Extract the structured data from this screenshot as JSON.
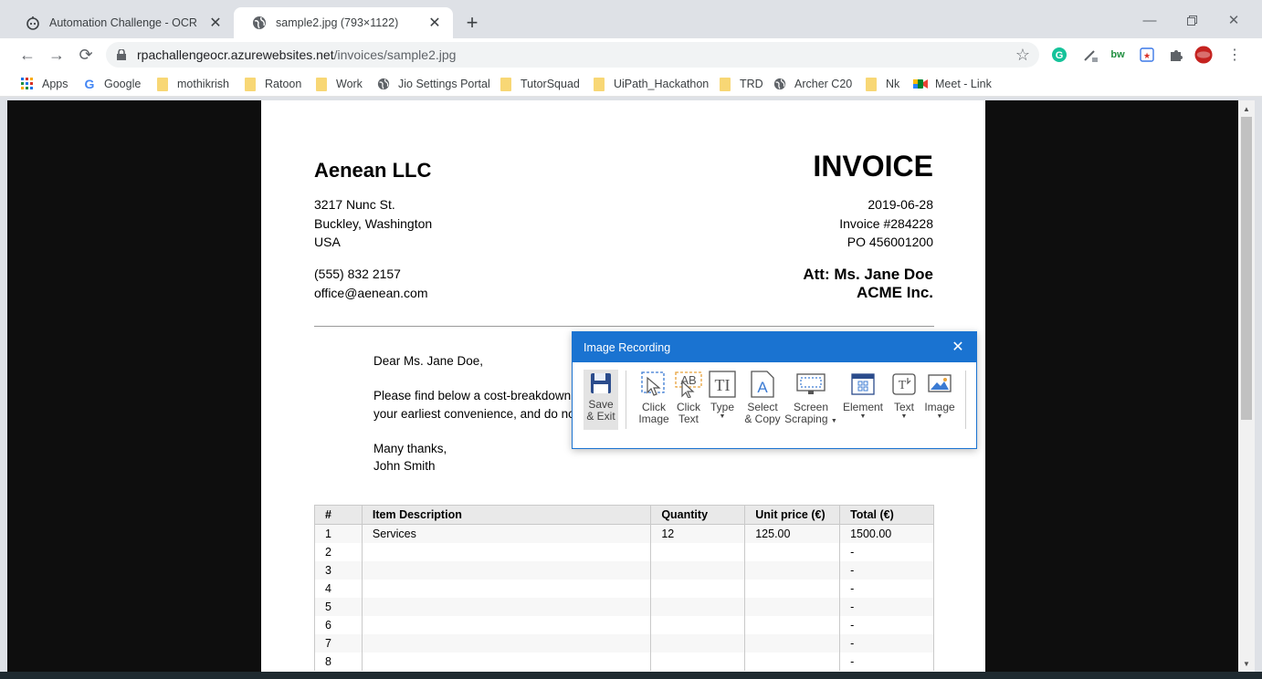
{
  "browser": {
    "tabs": [
      {
        "title": "Automation Challenge - OCR",
        "icon": "robot-icon",
        "active": false
      },
      {
        "title": "sample2.jpg (793×1122)",
        "icon": "globe-icon",
        "active": true
      }
    ],
    "url": {
      "host": "rpachallengeocr.azurewebsites.net",
      "path": "/invoices/sample2.jpg"
    },
    "bookmarks": [
      {
        "label": "Apps",
        "icon": "apps-grid-icon"
      },
      {
        "label": "Google",
        "icon": "google-icon"
      },
      {
        "label": "mothikrish",
        "icon": "folder-icon"
      },
      {
        "label": "Ratoon",
        "icon": "folder-icon"
      },
      {
        "label": "Work",
        "icon": "folder-icon"
      },
      {
        "label": "Jio Settings Portal",
        "icon": "globe-icon"
      },
      {
        "label": "TutorSquad",
        "icon": "folder-icon"
      },
      {
        "label": "UiPath_Hackathon",
        "icon": "folder-icon"
      },
      {
        "label": "TRD",
        "icon": "folder-icon"
      },
      {
        "label": "Archer C20",
        "icon": "globe-icon"
      },
      {
        "label": "Nk",
        "icon": "folder-icon"
      },
      {
        "label": "Meet - Link",
        "icon": "meet-icon"
      }
    ]
  },
  "invoice": {
    "company": "Aenean LLC",
    "title": "INVOICE",
    "address": [
      "3217 Nunc St.",
      "Buckley, Washington",
      "USA"
    ],
    "phone": "(555) 832 2157",
    "email": "office@aenean.com",
    "date": "2019-06-28",
    "invoice_no": "Invoice #284228",
    "po": "PO 456001200",
    "att": "Att: Ms. Jane Doe",
    "client": "ACME Inc.",
    "greeting": "Dear Ms. Jane Doe,",
    "body1": "Please find below a cost-breakdown f",
    "body2": "your earliest convenience, and do not",
    "thanks": "Many thanks,",
    "signature": "John Smith",
    "table": {
      "headers": [
        "#",
        "Item Description",
        "Quantity",
        "Unit price (€)",
        "Total (€)"
      ],
      "rows": [
        [
          "1",
          "Services",
          "12",
          "125.00",
          "1500.00"
        ],
        [
          "2",
          "",
          "",
          "",
          "-"
        ],
        [
          "3",
          "",
          "",
          "",
          "-"
        ],
        [
          "4",
          "",
          "",
          "",
          "-"
        ],
        [
          "5",
          "",
          "",
          "",
          "-"
        ],
        [
          "6",
          "",
          "",
          "",
          "-"
        ],
        [
          "7",
          "",
          "",
          "",
          "-"
        ],
        [
          "8",
          "",
          "",
          "",
          "-"
        ]
      ]
    }
  },
  "dialog": {
    "title": "Image Recording",
    "tools": [
      {
        "line1": "Save",
        "line2": "& Exit",
        "icon": "save-disk-icon"
      },
      {
        "line1": "Click",
        "line2": "Image",
        "icon": "click-image-icon"
      },
      {
        "line1": "Click",
        "line2": "Text",
        "icon": "click-text-icon"
      },
      {
        "line1": "Type",
        "line2": "",
        "icon": "type-icon"
      },
      {
        "line1": "Select",
        "line2": "& Copy",
        "icon": "select-copy-icon"
      },
      {
        "line1": "Screen",
        "line2": "Scraping",
        "icon": "screen-scraping-icon"
      },
      {
        "line1": "Element",
        "line2": "",
        "icon": "element-icon"
      },
      {
        "line1": "Text",
        "line2": "",
        "icon": "text-icon"
      },
      {
        "line1": "Image",
        "line2": "",
        "icon": "image-icon"
      }
    ]
  }
}
